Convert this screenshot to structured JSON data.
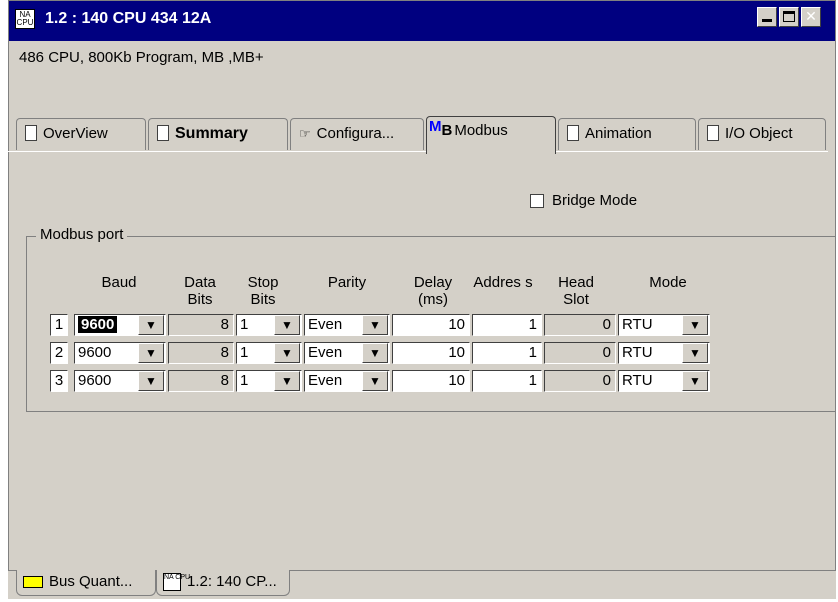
{
  "window": {
    "title": "1.2 : 140 CPU 434 12A",
    "title_icon_text": "NA CPU",
    "description": "486 CPU, 800Kb Program, MB ,MB+"
  },
  "tabs": [
    {
      "label": "OverView",
      "icon": "module-icon"
    },
    {
      "label": "Summary",
      "icon": "module-icon"
    },
    {
      "label": "Configura...",
      "icon": "config-hand-icon"
    },
    {
      "label": "Modbus",
      "icon_text": "MB",
      "active": true
    },
    {
      "label": "Animation",
      "icon": "module-icon"
    },
    {
      "label": "I/O Object",
      "icon": "module-icon"
    }
  ],
  "bridge_mode": {
    "label": "Bridge Mode",
    "checked": false
  },
  "modbus_port": {
    "group_label": "Modbus port",
    "headers": {
      "baud": "Baud",
      "data_bits": "Data Bits",
      "stop_bits": "Stop Bits",
      "parity": "Parity",
      "delay": "Delay (ms)",
      "address": "Addres s",
      "head_slot": "Head Slot",
      "mode": "Mode"
    },
    "rows": [
      {
        "num": "1",
        "baud": "9600",
        "data_bits": "8",
        "stop_bits": "1",
        "parity": "Even",
        "delay": "10",
        "address": "1",
        "head_slot": "0",
        "mode": "RTU"
      },
      {
        "num": "2",
        "baud": "9600",
        "data_bits": "8",
        "stop_bits": "1",
        "parity": "Even",
        "delay": "10",
        "address": "1",
        "head_slot": "0",
        "mode": "RTU"
      },
      {
        "num": "3",
        "baud": "9600",
        "data_bits": "8",
        "stop_bits": "1",
        "parity": "Even",
        "delay": "10",
        "address": "1",
        "head_slot": "0",
        "mode": "RTU"
      }
    ]
  },
  "bottom_tabs": [
    {
      "label": "Bus Quant...",
      "icon": "bus-icon"
    },
    {
      "label": "1.2: 140 CP...",
      "icon_text": "NA CPU"
    }
  ],
  "colors": {
    "titlebar": "#000080",
    "face": "#d4d0c8",
    "mb_blue": "#0000ff"
  }
}
